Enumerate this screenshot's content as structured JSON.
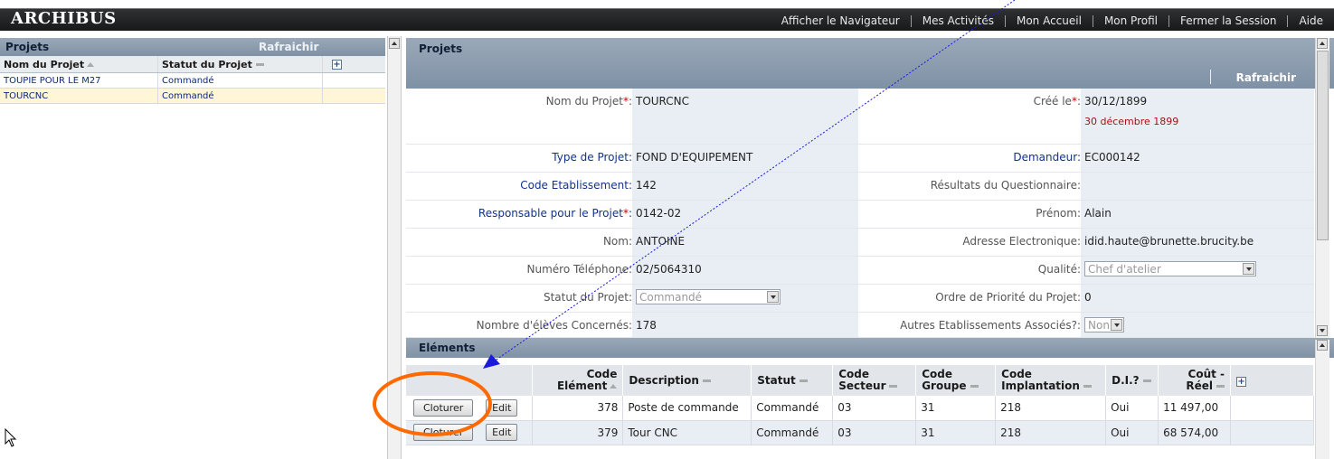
{
  "app": {
    "logo": "ARCHIBUS",
    "nav": [
      "Afficher le Navigateur",
      "Mes Activités",
      "Mon Accueil",
      "Mon Profil",
      "Fermer la Session",
      "Aide"
    ]
  },
  "left_panel": {
    "title": "Projets",
    "refresh_label": "Rafraichir",
    "columns": [
      "Nom du Projet",
      "Statut du Projet"
    ],
    "rows": [
      {
        "name": "TOUPIE POUR LE M27",
        "status": "Commandé"
      },
      {
        "name": "TOURCNC",
        "status": "Commandé"
      }
    ]
  },
  "project_form": {
    "title": "Projets",
    "refresh_label": "Rafraichir",
    "fields": {
      "nom_projet": {
        "label": "Nom du Projet",
        "value": "TOURCNC"
      },
      "cree_le": {
        "label": "Créé le",
        "value": "30/12/1899",
        "long_date": "30 décembre 1899"
      },
      "type_projet": {
        "label": "Type de Projet:",
        "value": "FOND D'EQUIPEMENT"
      },
      "demandeur": {
        "label": "Demandeur:",
        "value": "EC000142"
      },
      "code_etab": {
        "label": "Code Etablissement:",
        "value": "142"
      },
      "resultats": {
        "label": "Résultats du Questionnaire:",
        "value": ""
      },
      "responsable": {
        "label": "Responsable pour le Projet",
        "value": "0142-02"
      },
      "prenom": {
        "label": "Prénom:",
        "value": "Alain"
      },
      "nom": {
        "label": "Nom:",
        "value": "ANTOINE"
      },
      "email": {
        "label": "Adresse Electronique:",
        "value": "idid.haute@brunette.brucity.be"
      },
      "telephone": {
        "label": "Numéro Téléphone:",
        "value": "02/5064310"
      },
      "qualite": {
        "label": "Qualité:",
        "value": "Chef d'atelier"
      },
      "statut": {
        "label": "Statut du Projet:",
        "value": "Commandé"
      },
      "priorite": {
        "label": "Ordre de Priorité du Projet:",
        "value": "0"
      },
      "eleves": {
        "label": "Nombre d'élèves Concernés:",
        "value": "178"
      },
      "autres": {
        "label": "Autres Etablissements Associés?:",
        "value": "Non"
      }
    }
  },
  "elements": {
    "title": "Eléments",
    "columns": {
      "code": "Code Elément",
      "description": "Description",
      "statut": "Statut",
      "secteur": "Code Secteur",
      "groupe": "Code Groupe",
      "implantation": "Code Implantation",
      "di": "D.I.?",
      "cout": "Coût - Réel"
    },
    "buttons": {
      "cloturer": "Cloturer",
      "edit": "Edit"
    },
    "rows": [
      {
        "code": "378",
        "description": "Poste de commande",
        "statut": "Commandé",
        "secteur": "03",
        "groupe": "31",
        "implantation": "218",
        "di": "Oui",
        "cout": "11 497,00"
      },
      {
        "code": "379",
        "description": "Tour CNC",
        "statut": "Commandé",
        "secteur": "03",
        "groupe": "31",
        "implantation": "218",
        "di": "Oui",
        "cout": "68 574,00"
      }
    ]
  },
  "colors": {
    "header_bar": "#1e2022",
    "panel_header": "#8c9db0",
    "label_blue": "#13328a",
    "value_bg": "#e8eef4",
    "required_star": "#cc0000",
    "annotation_ellipse": "#ff6a00",
    "annotation_arrow": "#1a1adb"
  }
}
